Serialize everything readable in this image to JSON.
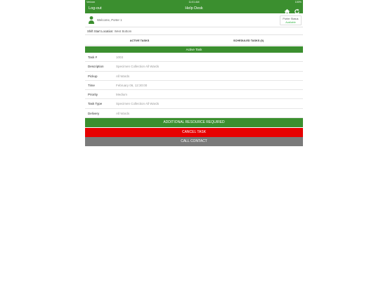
{
  "status_bar": {
    "carrier": "Verizon",
    "time": "11:01 AM",
    "battery": "100%"
  },
  "navbar": {
    "logout_label": "Log-out",
    "title": "Help Desk",
    "home_icon": "home-icon",
    "refresh_icon": "refresh-icon"
  },
  "welcome": {
    "greeting": "Welcome, Porter 1",
    "porter_status_label": "Porter Status",
    "porter_status_value": "Available"
  },
  "shift": {
    "label": "Shift Start Location:",
    "value": "West Bottom"
  },
  "tabs": [
    {
      "label": "ACTIVE TASKS",
      "active": true
    },
    {
      "label": "SCHEDULED TASKS (0)",
      "active": false
    }
  ],
  "section_title": "Active Task",
  "task": {
    "rows": [
      {
        "label": "Task #",
        "value": "1003"
      },
      {
        "label": "Description",
        "value": "Specimen Collection All Wards"
      },
      {
        "label": "Pickup",
        "value": "All Wards"
      },
      {
        "label": "Time",
        "value": "February 06, 12:30:00"
      },
      {
        "label": "Priority",
        "value": "Medium"
      },
      {
        "label": "Task Type",
        "value": "Specimen Collection All Wards"
      },
      {
        "label": "Delivery",
        "value": "All Wards"
      }
    ]
  },
  "actions": {
    "additional_resource": "ADDITIONAL RESOURCE REQUIRED",
    "cancel_task": "CANCEL TASK",
    "call_contact": "CALL CONTACT"
  },
  "colors": {
    "brand_green": "#3b8f2f",
    "cancel_red": "#e60000",
    "call_gray": "#7a7a7a",
    "status_available": "#39b54a"
  }
}
